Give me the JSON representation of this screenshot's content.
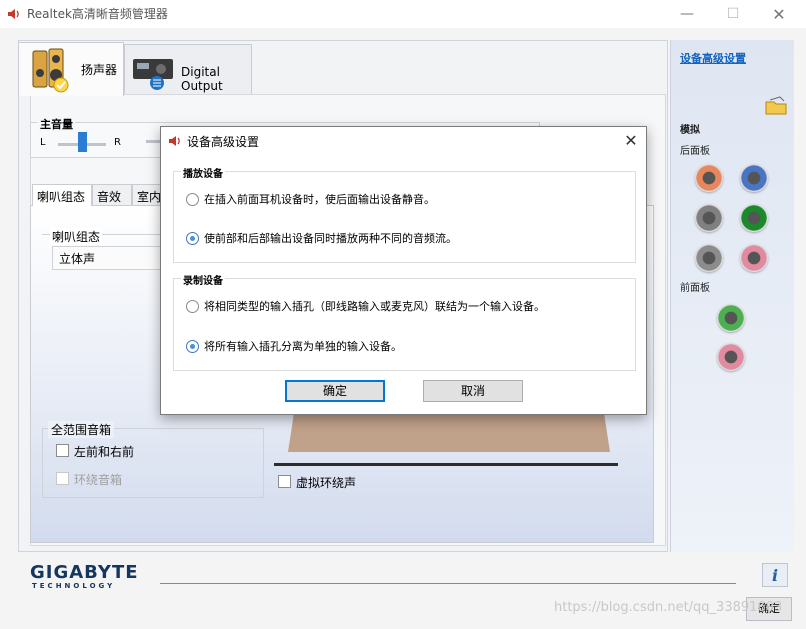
{
  "window": {
    "title": "Realtek高清晰音频管理器",
    "icon": "speaker-icon",
    "controls": {
      "minimize": "—",
      "maximize": "☐",
      "close": "✕"
    }
  },
  "tabs": [
    {
      "label": "扬声器",
      "icon": "speakers-icon",
      "active": true
    },
    {
      "label": "Digital Output",
      "icon": "digital-output-icon",
      "active": false
    }
  ],
  "volume": {
    "title": "主音量",
    "left": "L",
    "right": "R"
  },
  "subtabs": [
    {
      "label": "喇叭组态",
      "active": true
    },
    {
      "label": "音效",
      "active": false
    },
    {
      "label": "室内",
      "active": false
    }
  ],
  "speaker_config": {
    "group_label": "喇叭组态",
    "selected": "立体声"
  },
  "fullrange": {
    "title": "全范围音箱",
    "front_lr": "左前和右前",
    "surround": "环绕音箱"
  },
  "virtual_surround": "虚拟环绕声",
  "right_panel": {
    "advanced_link": "设备高级设置",
    "analog": "模拟",
    "back_panel": "后面板",
    "front_panel": "前面板",
    "back_jacks": [
      "#e8875c",
      "#4a74c4",
      "#808080",
      "#1a8a2a",
      "#8c8c8c",
      "#e28aa0"
    ],
    "front_jacks": [
      "#4caf50",
      "#e28aa0"
    ]
  },
  "brand": {
    "name": "GIGABYTE",
    "tagline": "TECHNOLOGY",
    "color": "#15365f"
  },
  "info_button": "i",
  "ok_main": "确定",
  "watermark": "https://blog.csdn.net/qq_33891603",
  "dialog": {
    "title": "设备高级设置",
    "close": "✕",
    "playback": {
      "title": "播放设备",
      "options": [
        {
          "label": "在插入前面耳机设备时，使后面输出设备静音。",
          "checked": false
        },
        {
          "label": "使前部和后部输出设备同时播放两种不同的音频流。",
          "checked": true
        }
      ]
    },
    "recording": {
      "title": "录制设备",
      "options": [
        {
          "label": "将相同类型的输入插孔（即线路输入或麦克风）联结为一个输入设备。",
          "checked": false
        },
        {
          "label": "将所有输入插孔分离为单独的输入设备。",
          "checked": true
        }
      ]
    },
    "ok": "确定",
    "cancel": "取消"
  }
}
